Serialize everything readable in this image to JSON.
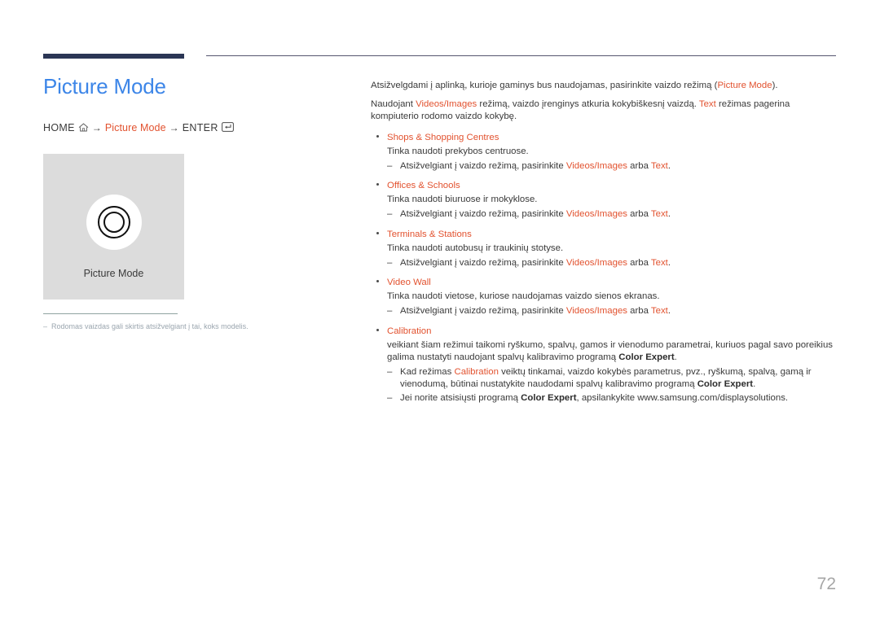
{
  "colors": {
    "accent": "#e2522f",
    "title_blue": "#3d86e8",
    "rule_navy": "#2b3655",
    "footnote_gray": "#9aa5ae",
    "panel_gray": "#dcdcdc",
    "page_number_gray": "#a6a6a6"
  },
  "page": {
    "title": "Picture Mode",
    "number": "72"
  },
  "breadcrumb": {
    "home_label": "HOME",
    "home_icon": "home-icon",
    "arrow": "→",
    "middle_label": "Picture Mode",
    "enter_label": "ENTER",
    "enter_icon": "enter-key-icon"
  },
  "illustration": {
    "icon": "double-circle-icon",
    "caption": "Picture Mode"
  },
  "footnote": {
    "dash": "–",
    "text": "Rodomas vaizdas gali skirtis atsižvelgiant į tai, koks modelis."
  },
  "body": {
    "para1": {
      "a": "Atsižvelgdami į aplinką, kurioje gaminys bus naudojamas, pasirinkite vaizdo režimą (",
      "accent": "Picture Mode",
      "b": ")."
    },
    "para2": {
      "a": "Naudojant ",
      "accent1": "Videos/Images",
      "b": " režimą, vaizdo įrenginys atkuria kokybiškesnį vaizdą. ",
      "accent2": "Text",
      "c": " režimas pagerina kompiuterio rodomo vaizdo kokybę."
    },
    "sub_common": {
      "dash": "–",
      "a": "Atsižvelgiant į vaizdo režimą, pasirinkite ",
      "accent1": "Videos/Images",
      "b": " arba ",
      "accent2": "Text",
      "c": "."
    },
    "bullets": [
      {
        "title": "Shops & Shopping Centres",
        "desc": "Tinka naudoti prekybos centruose."
      },
      {
        "title": "Offices & Schools",
        "desc": "Tinka naudoti biuruose ir mokyklose."
      },
      {
        "title": "Terminals & Stations",
        "desc": "Tinka naudoti autobusų ir traukinių stotyse."
      },
      {
        "title": "Video Wall",
        "desc": "Tinka naudoti vietose, kuriose naudojamas vaizdo sienos ekranas."
      }
    ],
    "calibration": {
      "title": "Calibration",
      "desc_a": "veikiant šiam režimui taikomi ryškumo, spalvų, gamos ir vienodumo parametrai, kuriuos pagal savo poreikius galima nustatyti naudojant spalvų kalibravimo programą ",
      "desc_bold": "Color Expert",
      "desc_b": ".",
      "sub1": {
        "dash": "–",
        "a": "Kad režimas ",
        "accent": "Calibration",
        "b": " veiktų tinkamai, vaizdo kokybės parametrus, pvz., ryškumą, spalvą, gamą ir vienodumą, būtinai nustatykite naudodami spalvų kalibravimo programą ",
        "bold": "Color Expert",
        "c": "."
      },
      "sub2": {
        "dash": "–",
        "a": "Jei norite atsisiųsti programą ",
        "bold": "Color Expert",
        "b": ", apsilankykite www.samsung.com/displaysolutions."
      }
    }
  }
}
